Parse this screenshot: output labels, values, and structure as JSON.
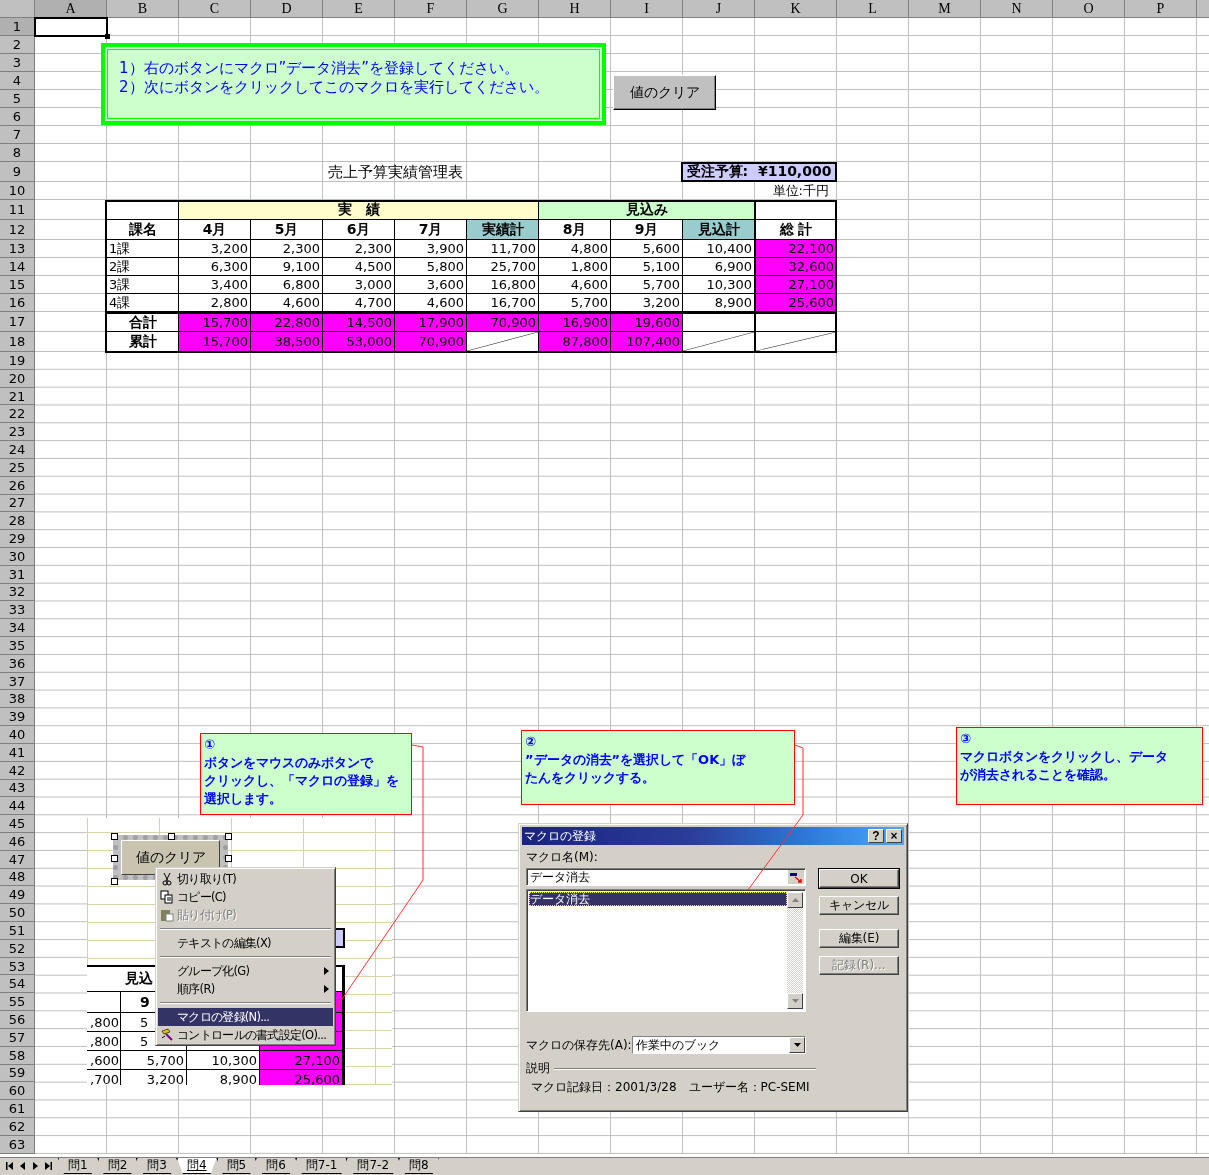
{
  "columns": [
    {
      "label": "A",
      "selected": true
    },
    {
      "label": "B",
      "selected": false
    },
    {
      "label": "C",
      "selected": false
    },
    {
      "label": "D",
      "selected": false
    },
    {
      "label": "E",
      "selected": false
    },
    {
      "label": "F",
      "selected": false
    },
    {
      "label": "G",
      "selected": false
    },
    {
      "label": "H",
      "selected": false
    },
    {
      "label": "I",
      "selected": false
    },
    {
      "label": "J",
      "selected": false
    },
    {
      "label": "K",
      "selected": false
    },
    {
      "label": "L",
      "selected": false
    },
    {
      "label": "M",
      "selected": false
    },
    {
      "label": "N",
      "selected": false
    },
    {
      "label": "O",
      "selected": false
    },
    {
      "label": "P",
      "selected": false
    }
  ],
  "rows": [
    {
      "label": "1",
      "selected": true
    },
    {
      "label": "2",
      "selected": false
    },
    {
      "label": "3",
      "selected": false
    },
    {
      "label": "4",
      "selected": false
    },
    {
      "label": "5",
      "selected": false
    },
    {
      "label": "6",
      "selected": false
    },
    {
      "label": "7",
      "selected": false
    },
    {
      "label": "8",
      "selected": false
    },
    {
      "label": "9",
      "selected": false
    },
    {
      "label": "10",
      "selected": false
    },
    {
      "label": "11",
      "selected": false
    },
    {
      "label": "12",
      "selected": false
    },
    {
      "label": "13",
      "selected": false
    },
    {
      "label": "14",
      "selected": false
    },
    {
      "label": "15",
      "selected": false
    },
    {
      "label": "16",
      "selected": false
    },
    {
      "label": "17",
      "selected": false
    },
    {
      "label": "18",
      "selected": false
    },
    {
      "label": "19",
      "selected": false
    },
    {
      "label": "20",
      "selected": false
    },
    {
      "label": "21",
      "selected": false
    },
    {
      "label": "22",
      "selected": false
    },
    {
      "label": "23",
      "selected": false
    },
    {
      "label": "24",
      "selected": false
    },
    {
      "label": "25",
      "selected": false
    },
    {
      "label": "26",
      "selected": false
    },
    {
      "label": "27",
      "selected": false
    },
    {
      "label": "28",
      "selected": false
    },
    {
      "label": "29",
      "selected": false
    },
    {
      "label": "30",
      "selected": false
    },
    {
      "label": "31",
      "selected": false
    },
    {
      "label": "32",
      "selected": false
    },
    {
      "label": "33",
      "selected": false
    },
    {
      "label": "34",
      "selected": false
    },
    {
      "label": "35",
      "selected": false
    },
    {
      "label": "36",
      "selected": false
    },
    {
      "label": "37",
      "selected": false
    },
    {
      "label": "38",
      "selected": false
    },
    {
      "label": "39",
      "selected": false
    },
    {
      "label": "40",
      "selected": false
    },
    {
      "label": "41",
      "selected": false
    },
    {
      "label": "42",
      "selected": false
    },
    {
      "label": "43",
      "selected": false
    },
    {
      "label": "44",
      "selected": false
    },
    {
      "label": "45",
      "selected": false
    },
    {
      "label": "46",
      "selected": false
    },
    {
      "label": "47",
      "selected": false
    },
    {
      "label": "48",
      "selected": false
    },
    {
      "label": "49",
      "selected": false
    },
    {
      "label": "50",
      "selected": false
    },
    {
      "label": "51",
      "selected": false
    },
    {
      "label": "52",
      "selected": false
    },
    {
      "label": "53",
      "selected": false
    },
    {
      "label": "54",
      "selected": false
    },
    {
      "label": "55",
      "selected": false
    },
    {
      "label": "56",
      "selected": false
    },
    {
      "label": "57",
      "selected": false
    },
    {
      "label": "58",
      "selected": false
    },
    {
      "label": "59",
      "selected": false
    },
    {
      "label": "60",
      "selected": false
    },
    {
      "label": "61",
      "selected": false
    },
    {
      "label": "62",
      "selected": false
    },
    {
      "label": "63",
      "selected": false
    }
  ],
  "instructions": {
    "lines": [
      "1）右のボタンにマクロ”データ消去”を登録してください。",
      "2）次にボタンをクリックしてこのマクロを実行してください。"
    ]
  },
  "clear_button": {
    "label": "値のクリア"
  },
  "report": {
    "title": "売上予算実績管理表",
    "budget": "受注予算:  ¥110,000",
    "unit": "単位:千円",
    "groups": [
      {
        "kind": "blank",
        "columns": [
          {
            "label": "課名",
            "kind": "name"
          }
        ]
      },
      {
        "kind": "group",
        "label": "実　績",
        "color": "#ffffcc",
        "columns": [
          {
            "label": "4月",
            "kind": "month"
          },
          {
            "label": "5月",
            "kind": "month"
          },
          {
            "label": "6月",
            "kind": "month"
          },
          {
            "label": "7月",
            "kind": "month"
          },
          {
            "label": "実績計",
            "kind": "subtotal"
          }
        ]
      },
      {
        "kind": "group",
        "label": "見込み",
        "color": "#ccffcc",
        "columns": [
          {
            "label": "8月",
            "kind": "month"
          },
          {
            "label": "9月",
            "kind": "month"
          },
          {
            "label": "見込計",
            "kind": "subtotal"
          }
        ]
      },
      {
        "kind": "blank",
        "columns": [
          {
            "label": "総 計",
            "kind": "total"
          }
        ]
      }
    ],
    "rows": [
      {
        "name": "1課",
        "cells": [
          "3,200",
          "2,300",
          "2,300",
          "3,900",
          "11,700",
          "4,800",
          "5,600",
          "10,400"
        ],
        "total": "22,100"
      },
      {
        "name": "2課",
        "cells": [
          "6,300",
          "9,100",
          "4,500",
          "5,800",
          "25,700",
          "1,800",
          "5,100",
          "6,900"
        ],
        "total": "32,600"
      },
      {
        "name": "3課",
        "cells": [
          "3,400",
          "6,800",
          "3,000",
          "3,600",
          "16,800",
          "4,600",
          "5,700",
          "10,300"
        ],
        "total": "27,100"
      },
      {
        "name": "4課",
        "cells": [
          "2,800",
          "4,600",
          "4,700",
          "4,600",
          "16,700",
          "5,700",
          "3,200",
          "8,900"
        ],
        "total": "25,600"
      }
    ],
    "summary": [
      {
        "label": "合計",
        "cells": [
          {
            "kind": "sum",
            "text": "15,700"
          },
          {
            "kind": "sum",
            "text": "22,800"
          },
          {
            "kind": "sum",
            "text": "14,500"
          },
          {
            "kind": "sum",
            "text": "17,900"
          },
          {
            "kind": "sum",
            "text": "70,900"
          },
          {
            "kind": "sum",
            "text": "16,900"
          },
          {
            "kind": "sum",
            "text": "19,600"
          },
          {
            "kind": "blank"
          },
          {
            "kind": "blank"
          }
        ]
      },
      {
        "label": "累計",
        "cells": [
          {
            "kind": "sum",
            "text": "15,700"
          },
          {
            "kind": "sum",
            "text": "38,500"
          },
          {
            "kind": "sum",
            "text": "53,000"
          },
          {
            "kind": "sum",
            "text": "70,900"
          },
          {
            "kind": "slash"
          },
          {
            "kind": "sum",
            "text": "87,800"
          },
          {
            "kind": "sum",
            "text": "107,400"
          },
          {
            "kind": "slash"
          },
          {
            "kind": "slash"
          }
        ]
      }
    ]
  },
  "callouts": [
    {
      "lines": [
        "①",
        "ボタンをマウスのみボタンで",
        "クリックし、「マクロの登録」を",
        "選択します。"
      ]
    },
    {
      "lines": [
        "②",
        "”データの消去”を選択して「OK」ぼ",
        "たんをクリックする。"
      ]
    },
    {
      "lines": [
        "③",
        "マクロボタンをクリックし、データ",
        "が消去されることを確認。"
      ]
    }
  ],
  "screenshot": {
    "button": "値のクリア",
    "menu": [
      {
        "kind": "item",
        "label": "切り取り(T)",
        "disabled": false,
        "selected": false
      },
      {
        "kind": "item",
        "label": "コピー(C)",
        "disabled": false,
        "selected": false
      },
      {
        "kind": "item",
        "label": "貼り付け(P)",
        "disabled": true,
        "selected": false
      },
      {
        "kind": "separator"
      },
      {
        "kind": "item",
        "label": "テキストの編集(X)",
        "disabled": false,
        "selected": false
      },
      {
        "kind": "separator"
      },
      {
        "kind": "submenu",
        "label": "グループ化(G)",
        "disabled": false,
        "selected": false
      },
      {
        "kind": "submenu",
        "label": "順序(R)",
        "disabled": false,
        "selected": false
      },
      {
        "kind": "separator"
      },
      {
        "kind": "item",
        "label": "マクロの登録(N)...",
        "disabled": false,
        "selected": true
      },
      {
        "kind": "item",
        "label": "コントロールの書式設定(O)...",
        "disabled": false,
        "selected": false
      }
    ],
    "table": {
      "group": "見込",
      "month": "9",
      "rows": [
        {
          "cells": [
            ",800",
            "5"
          ]
        },
        {
          "cells": [
            ",800",
            "5"
          ]
        },
        {
          "cells": [
            ",600",
            "5,700",
            "10,300",
            "27,100"
          ]
        },
        {
          "cells": [
            ",700",
            "3,200",
            "8,900",
            "25,600"
          ]
        }
      ]
    }
  },
  "dialog": {
    "title": "マクロの登録",
    "help": "?",
    "close": "×",
    "name_label": "マクロ名(M):",
    "name_value": "データ消去",
    "list": [
      {
        "label": "データ消去",
        "selected": true
      }
    ],
    "buttons": [
      {
        "label": "OK",
        "disabled": false
      },
      {
        "label": "キャンセル",
        "disabled": false
      },
      {
        "label": "編集(E)",
        "disabled": false
      },
      {
        "label": "記録(R)...",
        "disabled": true
      }
    ],
    "store_label": "マクロの保存先(A):",
    "store_value": "作業中のブック",
    "description_label": "説明",
    "description": "マクロ記録日：2001/3/28　ユーザー名：PC-SEMI"
  },
  "sheet_tabs": [
    {
      "label": "問1",
      "selected": false
    },
    {
      "label": "問2",
      "selected": false
    },
    {
      "label": "問3",
      "selected": false
    },
    {
      "label": "問4",
      "selected": true
    },
    {
      "label": "問5",
      "selected": false
    },
    {
      "label": "問6",
      "selected": false
    },
    {
      "label": "問7-1",
      "selected": false
    },
    {
      "label": "問7-2",
      "selected": false
    },
    {
      "label": "問8",
      "selected": false
    }
  ]
}
